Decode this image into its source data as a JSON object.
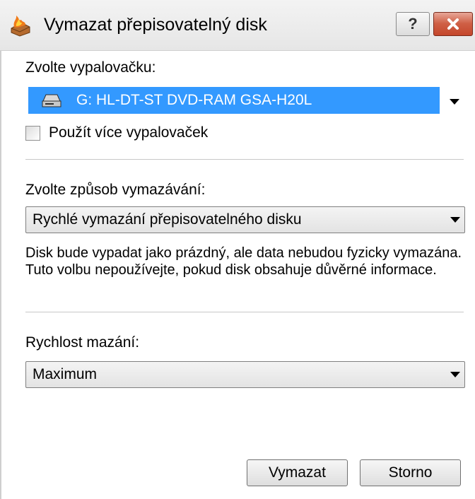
{
  "window": {
    "title": "Vymazat přepisovatelný disk",
    "help_label": "?"
  },
  "burner": {
    "label": "Zvolte vypalovačku:",
    "selected": "G: HL-DT-ST DVD-RAM GSA-H20L"
  },
  "multi": {
    "label": "Použít více vypalovaček",
    "checked": false
  },
  "erase_method": {
    "label": "Zvolte způsob vymazávání:",
    "selected": "Rychlé vymazání přepisovatelného disku",
    "description": "Disk bude vypadat jako prázdný, ale data nebudou fyzicky vymazána. Tuto volbu nepoužívejte, pokud disk obsahuje důvěrné informace."
  },
  "speed": {
    "label": "Rychlost mazání:",
    "selected": "Maximum"
  },
  "buttons": {
    "ok": "Vymazat",
    "cancel": "Storno"
  },
  "colors": {
    "selection": "#3399ff",
    "close_button": "#c4472c"
  },
  "icons": {
    "app": "burner-flame-icon",
    "drive": "optical-drive-icon",
    "help": "help-icon",
    "close": "close-icon",
    "dropdown": "dropdown-arrow-icon"
  }
}
